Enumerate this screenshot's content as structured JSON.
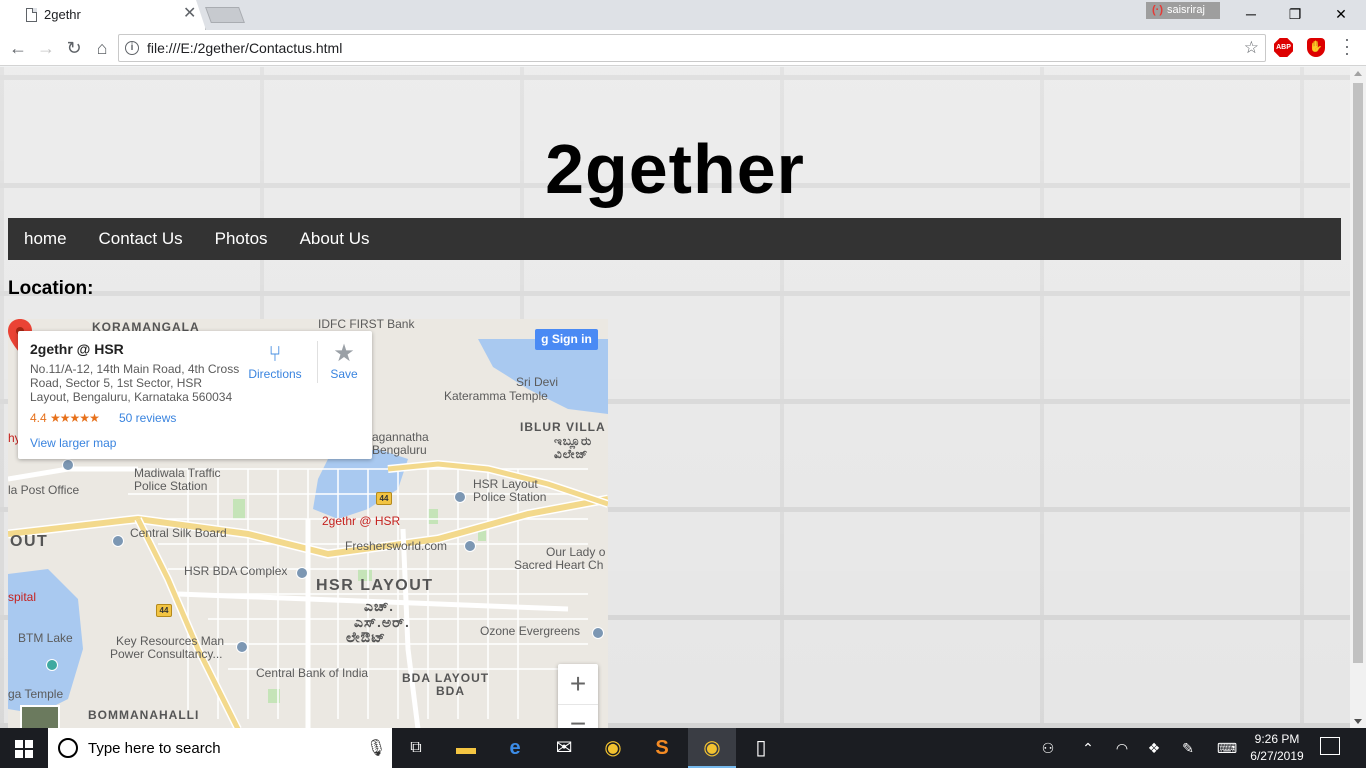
{
  "browser": {
    "tab_title": "2gethr",
    "tab_close": "✕",
    "profile_name": "saisriraj",
    "url": "file:///E:/2gether/Contactus.html",
    "win_min": "─",
    "win_max": "❐",
    "win_close": "✕"
  },
  "page": {
    "site_title": "2gether",
    "nav": [
      "home",
      "Contact Us",
      "Photos",
      "About Us"
    ],
    "location_label": "Location:"
  },
  "map": {
    "place_name": "2gethr @ HSR",
    "address": "No.11/A-12, 14th Main Road, 4th Cross Road, Sector 5, 1st Sector, HSR Layout, Bengaluru, Karnataka 560034",
    "rating": "4.4",
    "stars": "★★★★★",
    "reviews": "50 reviews",
    "view_larger": "View larger map",
    "directions": "Directions",
    "save": "Save",
    "sign_in": "Sign in",
    "pin_label": "2gethr @ HSR",
    "labels": {
      "koramangala": "KORAMANGALA",
      "idfc": "IDFC FIRST Bank",
      "sri_devi": "Sri Devi",
      "kateramma": "Kateramma Temple",
      "iblur": "IBLUR VILLA",
      "iblur_kn": "ಇಬ್ಲೂರು ವಿಲೇಜ್",
      "jagannatha": "agannatha",
      "jagannatha2": "Bengaluru",
      "madiwala": "Madiwala Traffic",
      "madiwala2": "Police Station",
      "post": "la Post Office",
      "silk": "Central Silk Board",
      "hsr_police": "HSR Layout",
      "hsr_police2": "Police Station",
      "freshers": "Freshersworld.com",
      "lady": "Our Lady o",
      "lady2": "Sacred Heart Ch",
      "out": "OUT",
      "bda": "HSR BDA Complex",
      "hsr_layout": "HSR LAYOUT",
      "hsr_kn1": "ಎಚ್.",
      "hsr_kn2": "ಎಸ್.ಅರ್.",
      "hsr_kn3": "ಲೇಔಟ್",
      "spital": "spital",
      "btm": "BTM Lake",
      "key": "Key Resources Man",
      "key2": "Power Consultancy...",
      "ozone": "Ozone Evergreens",
      "cbi": "Central Bank of India",
      "bda_layout": "BDA LAYOUT",
      "bda_kn": "BDA",
      "temple": "ga Temple",
      "bommanahalli": "BOMMANAHALLI",
      "hy": "hy",
      "hwy": "44"
    }
  },
  "taskbar": {
    "search_placeholder": "Type here to search",
    "time": "9:26 PM",
    "date": "6/27/2019"
  },
  "colors": {
    "navbar": "#333333",
    "accent_blue": "#3a84df",
    "pin_red": "#ea4335",
    "taskbar": "#1b1d22"
  }
}
